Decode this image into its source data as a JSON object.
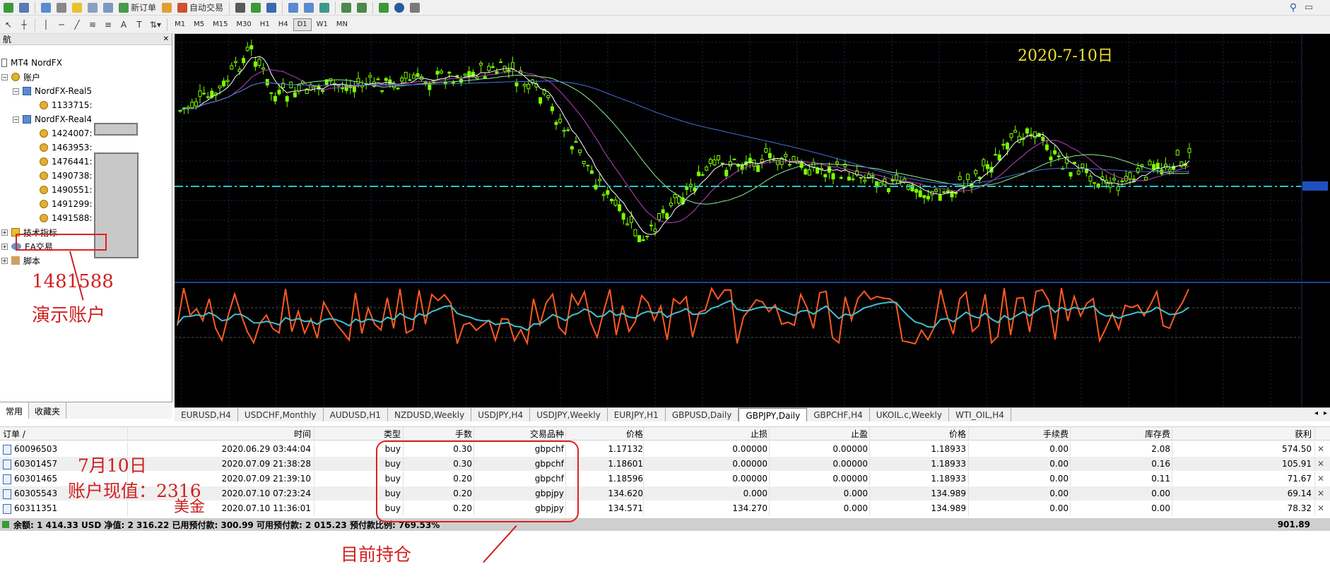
{
  "toolbar": {
    "new_order": "新订单",
    "auto_trade": "自动交易",
    "timeframes": [
      "M1",
      "M5",
      "M15",
      "M30",
      "H1",
      "H4",
      "D1",
      "W1",
      "MN"
    ],
    "active_timeframe": "D1"
  },
  "navigator": {
    "title": "航",
    "root": "MT4 NordFX",
    "accounts_label": "账户",
    "servers": [
      {
        "name": "NordFX-Real5",
        "accounts": [
          "1133715:"
        ]
      },
      {
        "name": "NordFX-Real4",
        "accounts": [
          "1424007:",
          "1463953:",
          "1476441:",
          "1490738:",
          "1490551:",
          "1491299:",
          "1491588:"
        ]
      }
    ],
    "other_nodes": [
      "技术指标",
      "EA交易",
      "脚本"
    ],
    "tabs": [
      "常用",
      "收藏夹"
    ],
    "active_tab": "常用"
  },
  "annotations": {
    "account_number": "1481588",
    "demo_account": "演示账户",
    "chart_date": "2020-7-10日",
    "date_note": "7月10日",
    "account_value": "账户现值：2316",
    "currency_unit": "美金",
    "current_positions": "目前持仓"
  },
  "chart_tabs": [
    "EURUSD,H4",
    "USDCHF,Monthly",
    "AUDUSD,H1",
    "NZDUSD,Weekly",
    "USDJPY,H4",
    "USDJPY,Weekly",
    "EURJPY,H1",
    "GBPUSD,Daily",
    "GBPJPY,Daily",
    "GBPCHF,H4",
    "UKOIL.c,Weekly",
    "WTI_OIL,H4"
  ],
  "active_chart_tab": "GBPJPY,Daily",
  "colors": {
    "candle": "#7cfc00",
    "ma_white": "#ffffff",
    "ma_magenta": "#c040c0",
    "ma_green": "#90ee90",
    "ma_blue": "#4a6cd4",
    "price_line": "#20c8c8",
    "osc_fast": "#ff5a20",
    "osc_slow": "#40c0d0",
    "annotation_red": "#d02020",
    "annotation_yellow": "#f0e030"
  },
  "trade": {
    "headers": [
      "订单 /",
      "时间",
      "类型",
      "手数",
      "交易品种",
      "价格",
      "止损",
      "止盈",
      "价格",
      "手续费",
      "库存费",
      "获利"
    ],
    "rows": [
      [
        "60096503",
        "2020.06.29 03:44:04",
        "buy",
        "0.30",
        "gbpchf",
        "1.17132",
        "0.00000",
        "0.00000",
        "1.18933",
        "0.00",
        "2.08",
        "574.50"
      ],
      [
        "60301457",
        "2020.07.09 21:38:28",
        "buy",
        "0.30",
        "gbpchf",
        "1.18601",
        "0.00000",
        "0.00000",
        "1.18933",
        "0.00",
        "0.16",
        "105.91"
      ],
      [
        "60301465",
        "2020.07.09 21:39:10",
        "buy",
        "0.20",
        "gbpchf",
        "1.18596",
        "0.00000",
        "0.00000",
        "1.18933",
        "0.00",
        "0.11",
        "71.67"
      ],
      [
        "60305543",
        "2020.07.10 07:23:24",
        "buy",
        "0.20",
        "gbpjpy",
        "134.620",
        "0.000",
        "0.000",
        "134.989",
        "0.00",
        "0.00",
        "69.14"
      ],
      [
        "60311351",
        "2020.07.10 11:36:01",
        "buy",
        "0.20",
        "gbpjpy",
        "134.571",
        "134.270",
        "0.000",
        "134.989",
        "0.00",
        "0.00",
        "78.32"
      ]
    ],
    "balance_line": "余额: 1 414.33 USD  净值: 2 316.22  已用预付款: 300.99  可用预付款: 2 015.23  预付款比例: 769.53%",
    "total_profit": "901.89"
  }
}
